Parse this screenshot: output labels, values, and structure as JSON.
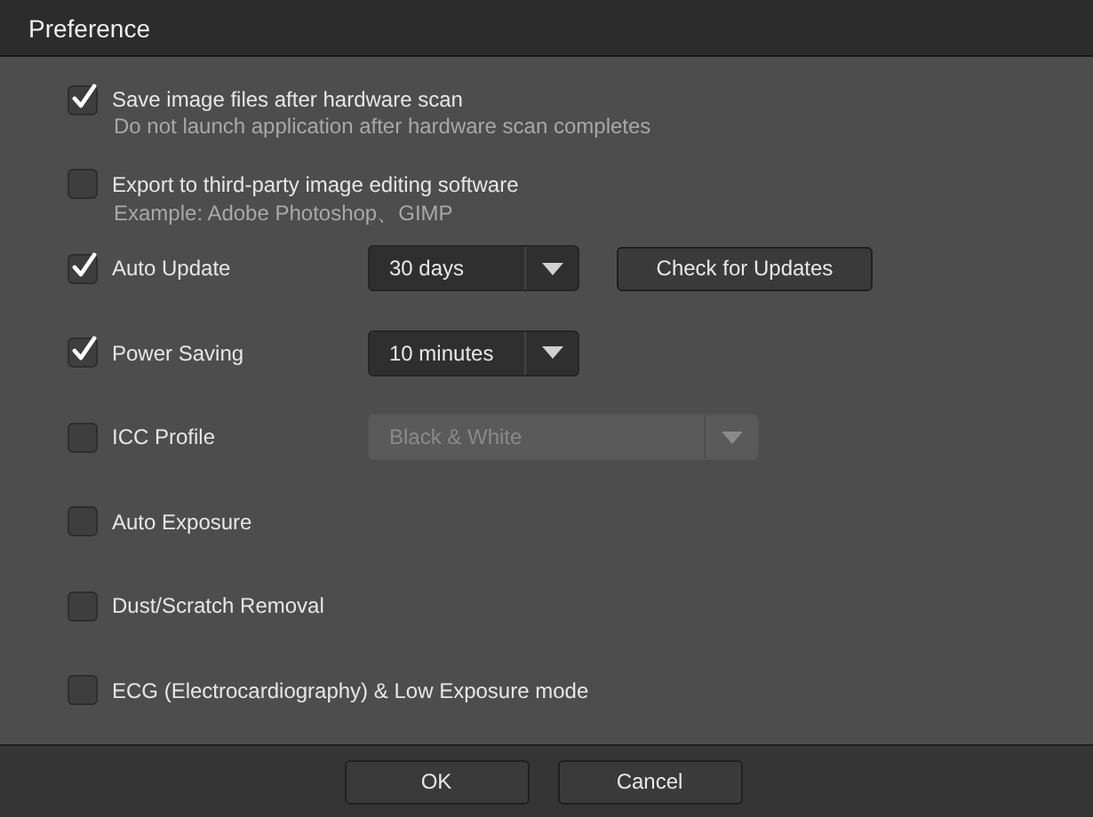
{
  "window": {
    "title": "Preference"
  },
  "options": [
    {
      "label": "Save image files after hardware scan",
      "checked": true,
      "description": "Do not launch application after hardware scan completes"
    },
    {
      "label": "Export to third-party image editing software",
      "checked": false,
      "description": "Example: Adobe Photoshop、GIMP"
    },
    {
      "label": "Auto Update",
      "checked": true,
      "dropdown": {
        "value": "30 days",
        "disabled": false
      },
      "button": "Check for Updates"
    },
    {
      "label": "Power Saving",
      "checked": true,
      "dropdown": {
        "value": "10 minutes",
        "disabled": false
      }
    },
    {
      "label": "ICC Profile",
      "checked": false,
      "dropdown": {
        "value": "Black & White",
        "disabled": true
      }
    },
    {
      "label": "Auto Exposure",
      "checked": false
    },
    {
      "label": "Dust/Scratch Removal",
      "checked": false
    },
    {
      "label": "ECG (Electrocardiography) & Low Exposure mode",
      "checked": false
    }
  ],
  "buttons": [
    "OK",
    "Cancel"
  ]
}
